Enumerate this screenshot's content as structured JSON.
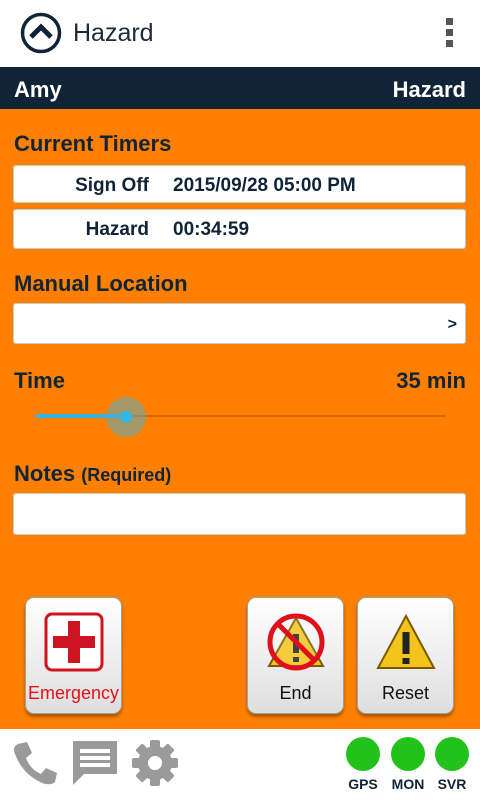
{
  "app": {
    "title": "Hazard",
    "logo_icon": "chevron-up-circle-icon",
    "menu_icon": "overflow-menu-icon"
  },
  "userbar": {
    "user": "Amy",
    "status": "Hazard"
  },
  "timers": {
    "title": "Current Timers",
    "rows": [
      {
        "label": "Sign Off",
        "value": "2015/09/28 05:00 PM"
      },
      {
        "label": "Hazard",
        "value": "00:34:59"
      }
    ]
  },
  "location": {
    "title": "Manual Location",
    "value": "",
    "chevron": ">"
  },
  "time": {
    "title": "Time",
    "value_label": "35 min",
    "slider_fraction": 0.22
  },
  "notes": {
    "title": "Notes",
    "qualifier": "(Required)",
    "value": ""
  },
  "actions": {
    "emergency": {
      "label": "Emergency",
      "icon": "red-cross-icon"
    },
    "end": {
      "label": "End",
      "icon": "no-hazard-icon"
    },
    "reset": {
      "label": "Reset",
      "icon": "warning-icon"
    }
  },
  "bottombar": {
    "icons": [
      "phone-icon",
      "message-icon",
      "gear-icon"
    ],
    "status": [
      {
        "label": "GPS",
        "color": "#22c21b"
      },
      {
        "label": "MON",
        "color": "#22c21b"
      },
      {
        "label": "SVR",
        "color": "#22c21b"
      }
    ]
  },
  "colors": {
    "background": "#FF8000",
    "header": "#0f2437",
    "accent": "#33b5e5",
    "status_ok": "#22c21b"
  }
}
